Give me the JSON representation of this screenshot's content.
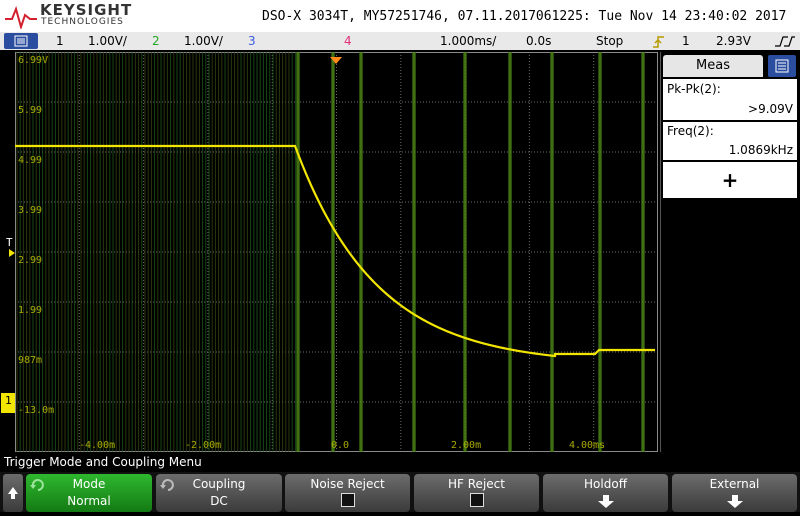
{
  "brand": {
    "name": "KEYSIGHT",
    "sub": "TECHNOLOGIES"
  },
  "title": "DSO-X 3034T, MY57251746, 07.11.2017061225: Tue Nov 14 23:40:02 2017",
  "status": {
    "ch1_num": "1",
    "ch1_scale": "1.00V/",
    "ch2_num": "2",
    "ch2_scale": "1.00V/",
    "ch3_num": "3",
    "ch4_num": "4",
    "timebase": "1.000ms/",
    "delay": "0.0s",
    "run_state": "Stop",
    "trig_src": "1",
    "trig_level": "2.93V"
  },
  "graticule": {
    "y_labels": [
      "6.99V",
      "5.99",
      "4.99",
      "3.99",
      "2.99",
      "1.99",
      "987m",
      "-13.0m"
    ],
    "x_labels": [
      "-4.00m",
      "-2.00m",
      "0.0",
      "2.00m",
      "4.00ms"
    ],
    "trigger_marker": "T",
    "ground_marker": "1"
  },
  "measurements": {
    "tab_label": "Meas",
    "items": [
      {
        "name": "Pk-Pk(2):",
        "value": ">9.09V"
      },
      {
        "name": "Freq(2):",
        "value": "1.0869kHz"
      }
    ],
    "add_label": "+"
  },
  "softmenu": {
    "title": "Trigger Mode and Coupling Menu",
    "keys": [
      {
        "label": "Mode",
        "value": "Normal"
      },
      {
        "label": "Coupling",
        "value": "DC"
      },
      {
        "label": "Noise Reject",
        "value": ""
      },
      {
        "label": "HF Reject",
        "value": ""
      },
      {
        "label": "Holdoff",
        "value": ""
      },
      {
        "label": "External",
        "value": ""
      }
    ]
  },
  "colors": {
    "ch1": "#f2e600",
    "ch2": "#22c422",
    "ch3": "#4a6cff",
    "ch4": "#ff3c8c",
    "accent": "#2b4d9f"
  }
}
